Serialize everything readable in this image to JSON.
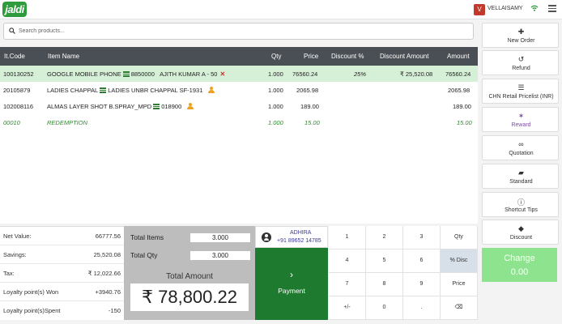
{
  "app": {
    "logo_text": "jaldi"
  },
  "user": {
    "initial": "V",
    "name": "VELLAISAMY"
  },
  "search": {
    "placeholder": "Search products..."
  },
  "table": {
    "headers": [
      "It.Code",
      "Item Name",
      "Qty",
      "Price",
      "Discount %",
      "Discount Amount",
      "Amount"
    ],
    "rows": [
      {
        "code": "100130252",
        "name": "GOOGLE MOBILE PHONE",
        "ref": "8850000",
        "salesperson": "AJITH KUMAR A - 50",
        "qty": "1.000",
        "price": "76560.24",
        "disc_pct": "25%",
        "disc_amt": "₹ 25,520.08",
        "amount": "76560.24"
      },
      {
        "code": "20105879",
        "name": "LADIES CHAPPAL",
        "ref": "LADIES UNBR CHAPPAL SF-1931",
        "qty": "1.000",
        "price": "2065.98",
        "disc_pct": "",
        "disc_amt": "",
        "amount": "2065.98"
      },
      {
        "code": "102008116",
        "name": "ALMAS LAYER SHOT B.SPRAY_MPD",
        "ref": "018900",
        "qty": "1.000",
        "price": "189.00",
        "disc_pct": "",
        "disc_amt": "",
        "amount": "189.00"
      },
      {
        "code": "00010",
        "name": "REDEMPTION",
        "qty": "1.000",
        "price": "15.00",
        "amount": "15.00"
      }
    ]
  },
  "sidebar": {
    "items": [
      {
        "icon": "plus-icon",
        "label": "New Order"
      },
      {
        "icon": "refund-icon",
        "label": "Refund"
      },
      {
        "icon": "list-icon",
        "label": "CHN Retail Pricelist (INR)"
      },
      {
        "icon": "reward-icon",
        "label": "Reward"
      },
      {
        "icon": "link-icon",
        "label": "Quotation"
      },
      {
        "icon": "truck-icon",
        "label": "Standard"
      },
      {
        "icon": "info-icon",
        "label": "Shortcut Tips"
      },
      {
        "icon": "tag-icon",
        "label": "Discount"
      }
    ],
    "change_label": "Change",
    "change_value": "0.00"
  },
  "summary": [
    {
      "label": "Net Value:",
      "value": "66777.56"
    },
    {
      "label": "Savings:",
      "value": "25,520.08"
    },
    {
      "label": "Tax:",
      "value": "₹ 12,022.66"
    },
    {
      "label": "Loyalty point(s) Won",
      "value": "+3940.76"
    },
    {
      "label": "Loyalty point(s)Spent",
      "value": "-150"
    }
  ],
  "totals": {
    "items_label": "Total Items",
    "items_value": "3.000",
    "qty_label": "Total Qty",
    "qty_value": "3.000",
    "amount_label": "Total Amount",
    "amount_value": "₹ 78,800.22"
  },
  "customer": {
    "name": "ADHIRA",
    "phone": "+91 89652 14785"
  },
  "payment": {
    "chevron": "›",
    "label": "Payment"
  },
  "keypad": {
    "keys": [
      "1",
      "2",
      "3",
      "Qty",
      "4",
      "5",
      "6",
      "% Disc",
      "7",
      "8",
      "9",
      "Price",
      "+/-",
      "0",
      ".",
      "⌫"
    ],
    "active": "% Disc"
  }
}
